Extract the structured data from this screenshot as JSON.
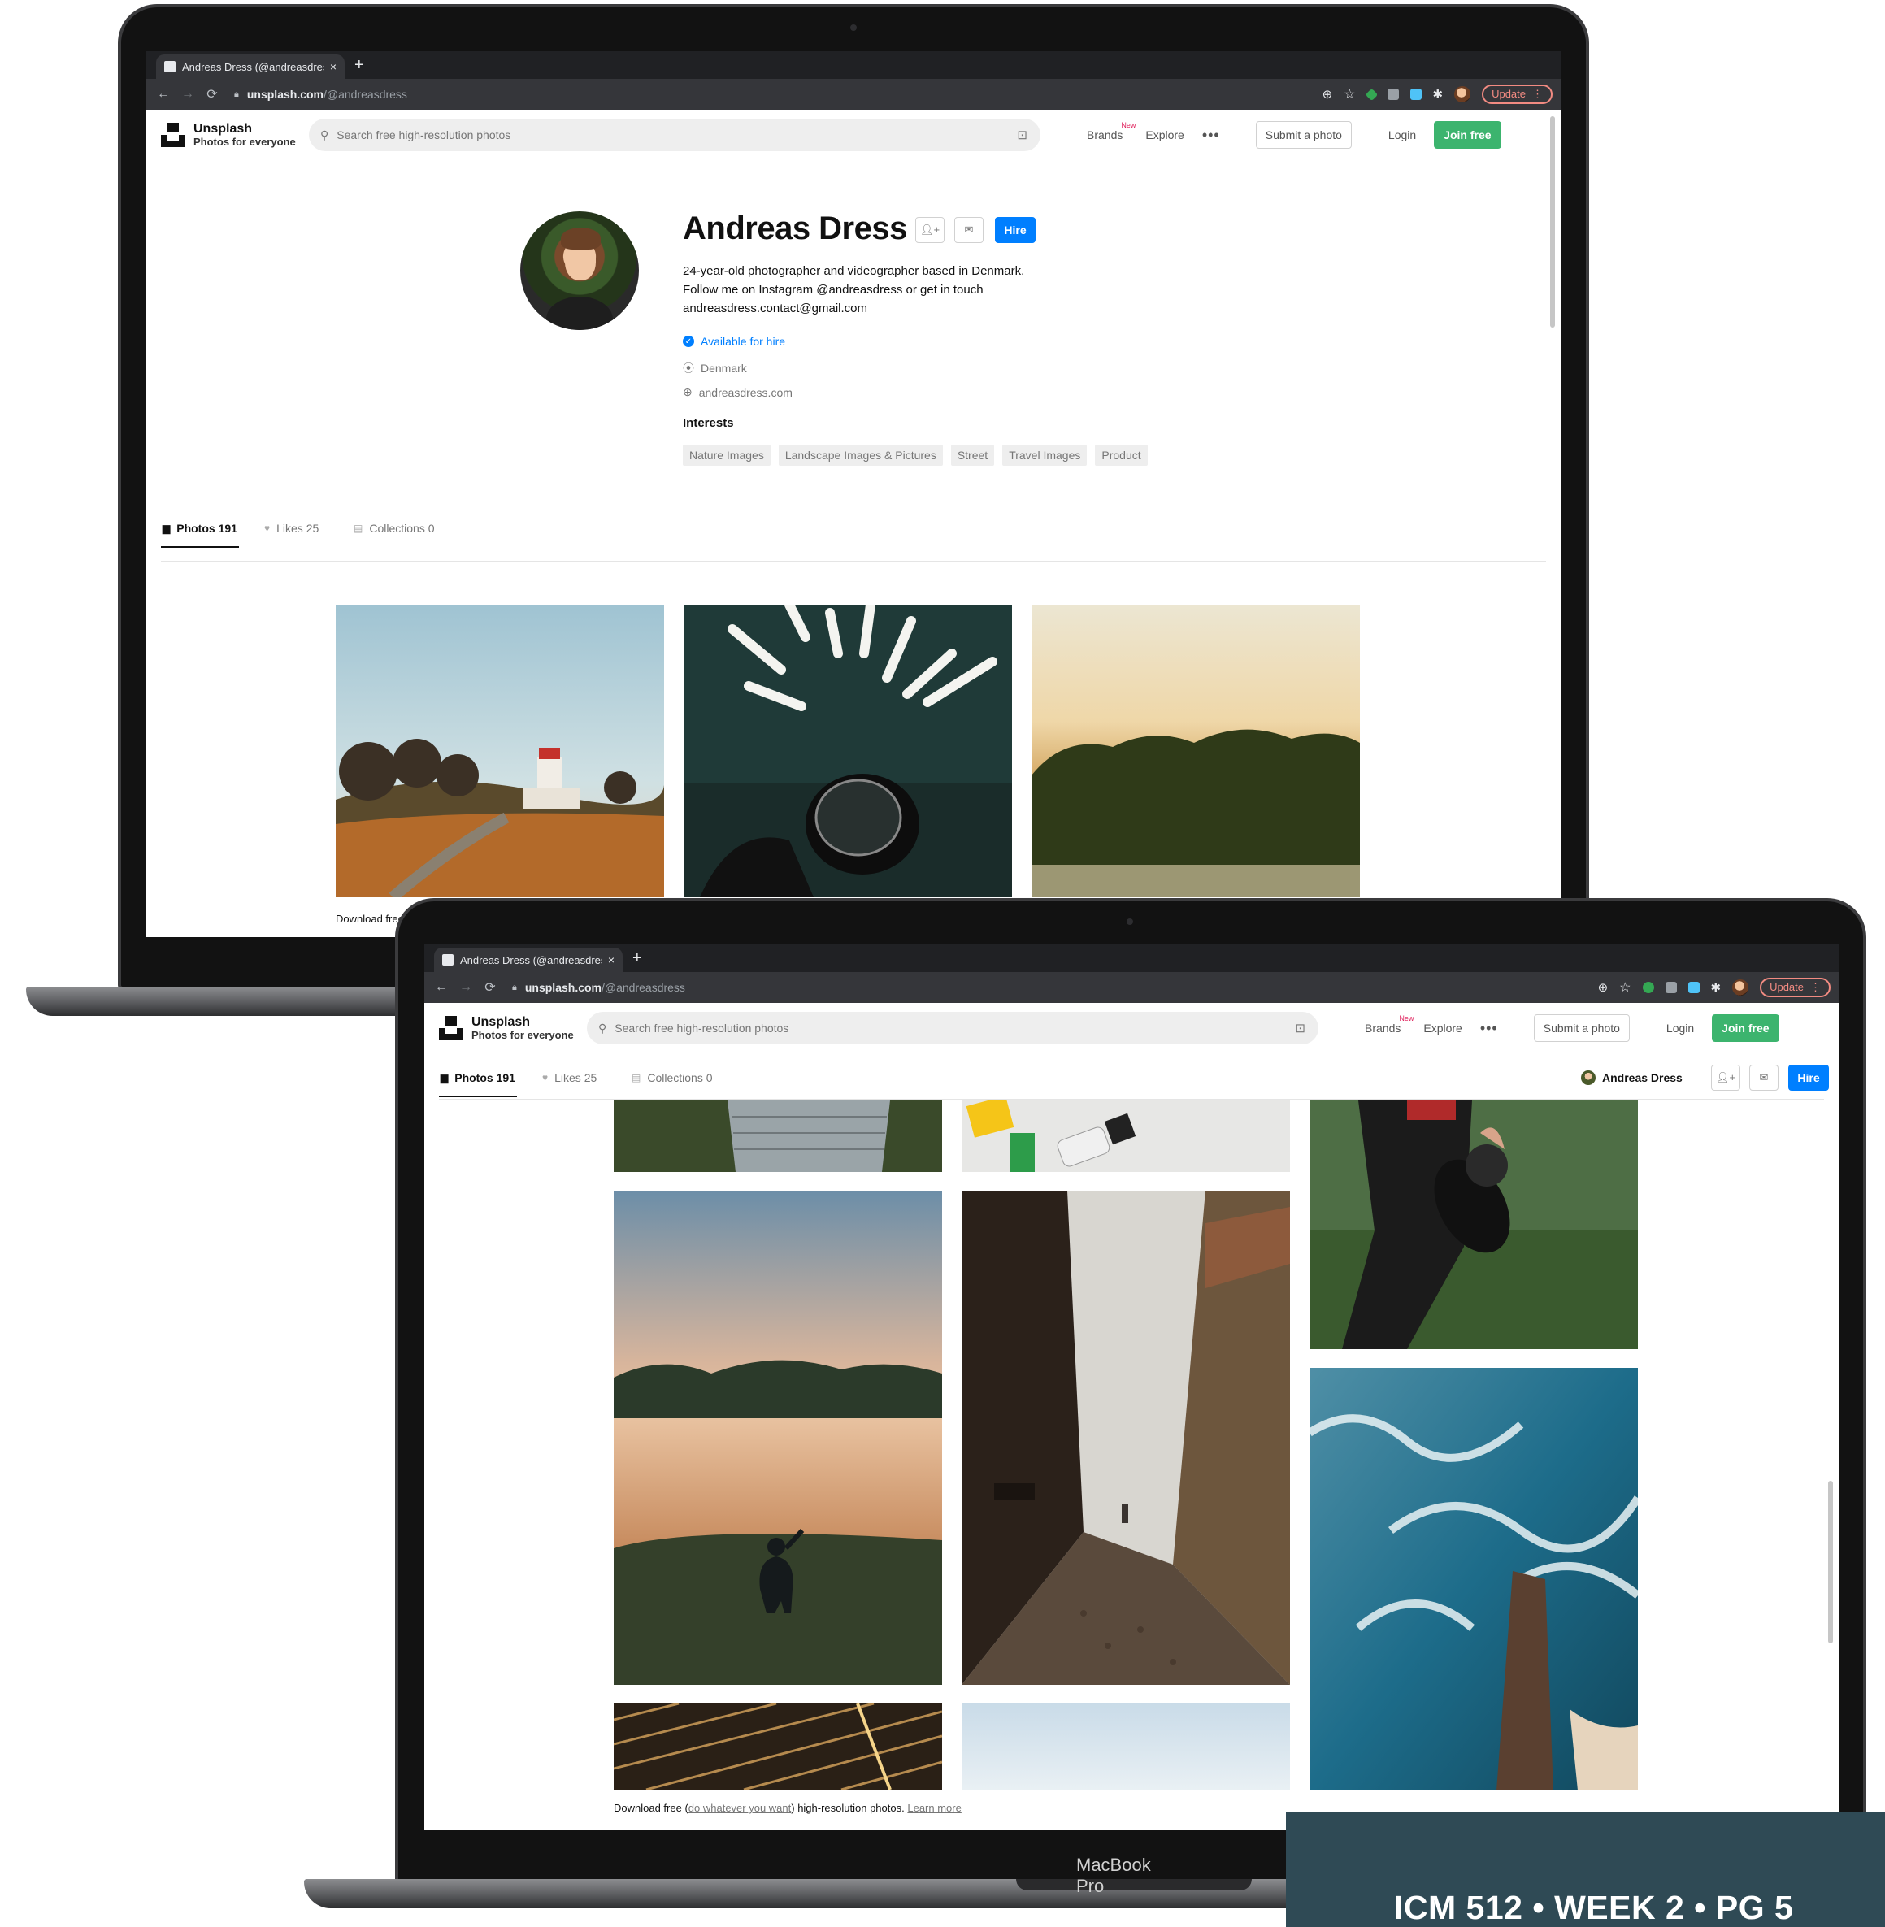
{
  "browser": {
    "tab_title": "Andreas Dress (@andreasdres",
    "tab_close": "×",
    "new_tab": "+",
    "url_host": "unsplash.com",
    "url_path": "/@andreasdress",
    "update_label": "Update",
    "update_menu": "⋮"
  },
  "header": {
    "logo_name": "Unsplash",
    "logo_tagline": "Photos for everyone",
    "search_placeholder": "Search free high-resolution photos",
    "brands": "Brands",
    "brands_badge": "New",
    "explore": "Explore",
    "more": "•••",
    "submit": "Submit a photo",
    "login": "Login",
    "join": "Join free"
  },
  "profile": {
    "name": "Andreas Dress",
    "hire": "Hire",
    "bio_lines": [
      "24-year-old photographer and videographer based in Denmark.",
      "Follow me on Instagram @andreasdress or get in touch",
      "andreasdress.contact@gmail.com"
    ],
    "available": "Available for hire",
    "location": "Denmark",
    "website": "andreasdress.com",
    "interests_title": "Interests",
    "interests": [
      "Nature Images",
      "Landscape Images & Pictures",
      "Street",
      "Travel Images",
      "Product"
    ]
  },
  "tabs": {
    "photos": "Photos 191",
    "likes": "Likes 25",
    "collections": "Collections 0"
  },
  "footer": {
    "prefix": "Download free (",
    "link1": "do whatever you want",
    "middle": ") high-resolution photos.",
    "link2": "Learn more",
    "cut": "Download free"
  },
  "device_label": "MacBook Pro",
  "caption": "ICM 512 • WEEK 2 • PG 5",
  "colors": {
    "accent_green": "#3cb46e",
    "accent_blue": "#007fff",
    "caption_bg": "#2f4a55"
  }
}
